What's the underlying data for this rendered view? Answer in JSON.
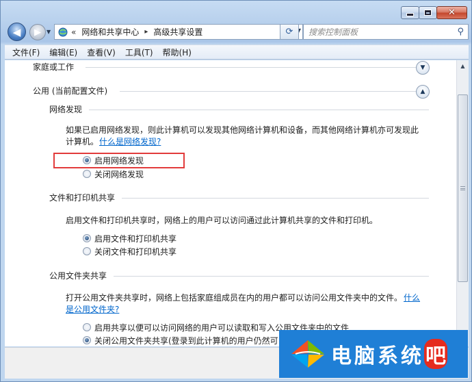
{
  "window": {
    "caption_buttons": [
      "minimize",
      "maximize",
      "close"
    ]
  },
  "nav": {
    "address_chevron": "«",
    "breadcrumb": [
      "网络和共享中心",
      "高级共享设置"
    ],
    "breadcrumb_separator": "▸",
    "search_placeholder": "搜索控制面板"
  },
  "menu": [
    "文件(F)",
    "编辑(E)",
    "查看(V)",
    "工具(T)",
    "帮助(H)"
  ],
  "profiles": {
    "home_work": {
      "title": "家庭或工作",
      "state": "collapsed"
    },
    "public": {
      "title": "公用 (当前配置文件)",
      "state": "expanded"
    }
  },
  "network_discovery": {
    "heading": "网络发现",
    "description_line1": "如果已启用网络发现，则此计算机可以发现其他网络计算机和设备，而其他网络计算机亦可发现此",
    "description_line2": "计算机。",
    "help_link": "什么是网络发现?",
    "options": [
      {
        "label": "启用网络发现",
        "selected": true,
        "highlighted": true
      },
      {
        "label": "关闭网络发现",
        "selected": false
      }
    ]
  },
  "file_printer_sharing": {
    "heading": "文件和打印机共享",
    "description": "启用文件和打印机共享时，网络上的用户可以访问通过此计算机共享的文件和打印机。",
    "options": [
      {
        "label": "启用文件和打印机共享",
        "selected": true
      },
      {
        "label": "关闭文件和打印机共享",
        "selected": false
      }
    ]
  },
  "public_folder_sharing": {
    "heading": "公用文件夹共享",
    "description_line1": "打开公用文件夹共享时，网络上包括家庭组成员在内的用户都可以访问公用文件夹中的文件。",
    "help_link_part1": "什么",
    "help_link_part2": "是公用文件夹?",
    "options": [
      {
        "label": "启用共享以便可以访问网络的用户可以读取和写入公用文件夹中的文件",
        "selected": false
      },
      {
        "label": "关闭公用文件夹共享(登录到此计算机的用户仍然可以",
        "selected": true
      }
    ]
  },
  "watermark": {
    "text_main": "电脑系统",
    "text_last": "吧"
  },
  "colors": {
    "link": "#0066cc",
    "highlight_border": "#e23b3b",
    "watermark_bg": "#1f7fd6"
  }
}
